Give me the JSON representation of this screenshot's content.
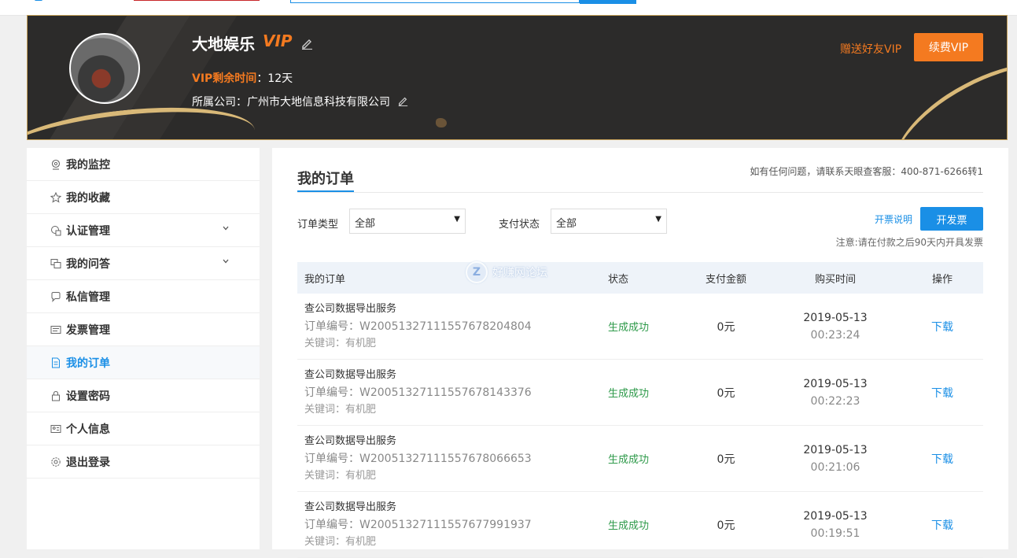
{
  "banner": {
    "username": "大地娱乐",
    "vip_label": "VIP",
    "vip_time_key": "VIP剩余时间",
    "vip_time_value": "：12天",
    "company_key": "所属公司：",
    "company_value": "广州市大地信息科技有限公司",
    "gift_vip_link": "赠送好友VIP",
    "renew_vip_button": "续费VIP"
  },
  "sidebar": {
    "items": [
      {
        "label": "我的监控",
        "icon": "monitor-icon"
      },
      {
        "label": "我的收藏",
        "icon": "star-icon"
      },
      {
        "label": "认证管理",
        "icon": "certificate-icon",
        "expandable": true
      },
      {
        "label": "我的问答",
        "icon": "qa-icon",
        "expandable": true
      },
      {
        "label": "私信管理",
        "icon": "message-icon"
      },
      {
        "label": "发票管理",
        "icon": "invoice-icon"
      },
      {
        "label": "我的订单",
        "icon": "order-icon",
        "active": true
      },
      {
        "label": "设置密码",
        "icon": "lock-icon"
      },
      {
        "label": "个人信息",
        "icon": "id-card-icon"
      },
      {
        "label": "退出登录",
        "icon": "gear-icon"
      }
    ]
  },
  "main": {
    "title": "我的订单",
    "contact": "如有任何问题，请联系天眼查客服：400-871-6266转1",
    "filters": {
      "order_type_label": "订单类型",
      "order_type_value": "全部",
      "pay_status_label": "支付状态",
      "pay_status_value": "全部"
    },
    "invoice_info_link": "开票说明",
    "invoice_button": "开发票",
    "note": "注意:请在付款之后90天内开具发票",
    "table": {
      "headers": {
        "order": "我的订单",
        "status": "状态",
        "amount": "支付金额",
        "time": "购买时间",
        "op": "操作"
      },
      "rows": [
        {
          "name": "查公司数据导出服务",
          "order_no": "订单编号：W20051327111557678204804",
          "keyword": "关键词：有机肥",
          "status": "生成成功",
          "amount": "0元",
          "date": "2019-05-13",
          "time": "00:23:24",
          "op": "下载"
        },
        {
          "name": "查公司数据导出服务",
          "order_no": "订单编号：W20051327111557678143376",
          "keyword": "关键词：有机肥",
          "status": "生成成功",
          "amount": "0元",
          "date": "2019-05-13",
          "time": "00:22:23",
          "op": "下载"
        },
        {
          "name": "查公司数据导出服务",
          "order_no": "订单编号：W20051327111557678066653",
          "keyword": "关键词：有机肥",
          "status": "生成成功",
          "amount": "0元",
          "date": "2019-05-13",
          "time": "00:21:06",
          "op": "下载"
        },
        {
          "name": "查公司数据导出服务",
          "order_no": "订单编号：W20051327111557677991937",
          "keyword": "关键词：有机肥",
          "status": "生成成功",
          "amount": "0元",
          "date": "2019-05-13",
          "time": "00:19:51",
          "op": "下载"
        }
      ]
    }
  },
  "watermark": {
    "text": "好赚网论坛",
    "glyph": "Z"
  },
  "colors": {
    "accent": "#1a8fe6",
    "vip": "#f47a20",
    "success": "#2e9a4a"
  }
}
